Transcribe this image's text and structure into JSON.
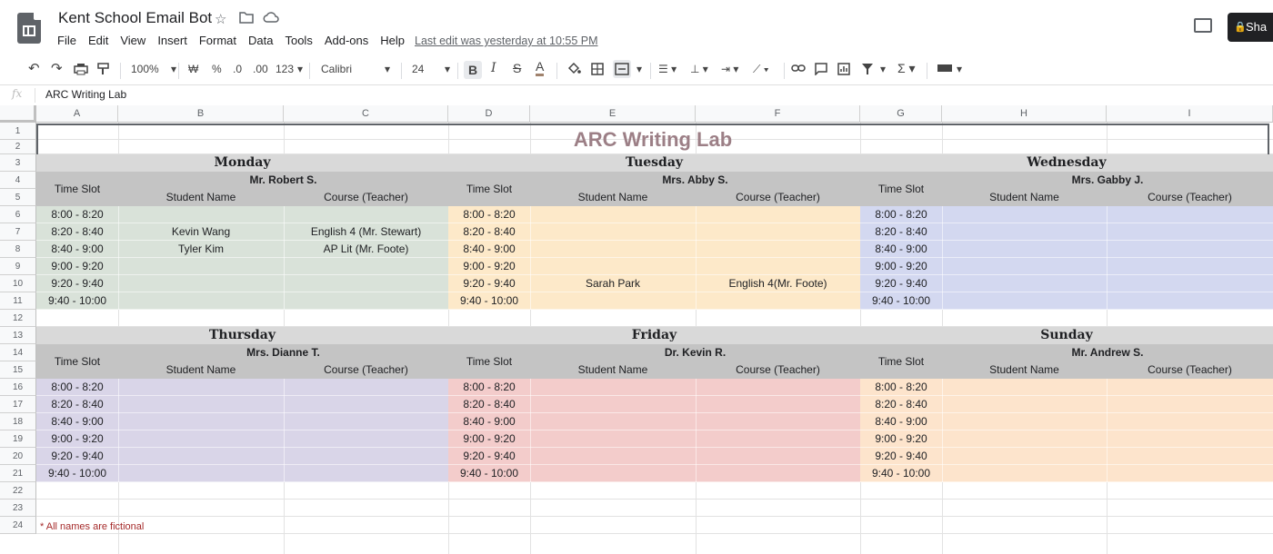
{
  "app": {
    "title": "Kent School Email Bot",
    "menu": [
      "File",
      "Edit",
      "View",
      "Insert",
      "Format",
      "Data",
      "Tools",
      "Add-ons",
      "Help"
    ],
    "last_edit": "Last edit was yesterday at 10:55 PM",
    "share_label": "Sha"
  },
  "toolbar": {
    "zoom": "100%",
    "currency": "₩",
    "percent": "%",
    "dec_less": ".0",
    "dec_more": ".00",
    "number_format": "123",
    "font": "Calibri",
    "font_size": "24"
  },
  "formula_bar": {
    "fx": "fx",
    "value": "ARC Writing Lab"
  },
  "columns": [
    "A",
    "B",
    "C",
    "D",
    "E",
    "F",
    "G",
    "H",
    "I"
  ],
  "rows": [
    "1",
    "2",
    "3",
    "4",
    "5",
    "6",
    "7",
    "8",
    "9",
    "10",
    "11",
    "12",
    "13",
    "14",
    "15",
    "16",
    "17",
    "18",
    "19",
    "20",
    "21",
    "22",
    "23",
    "24"
  ],
  "sheet": {
    "title": "ARC Writing Lab",
    "time_slot_label": "Time Slot",
    "student_label": "Student Name",
    "course_label": "Course (Teacher)",
    "time_slots": [
      "8:00 - 8:20",
      "8:20 - 8:40",
      "8:40 - 9:00",
      "9:00 - 9:20",
      "9:20 - 9:40",
      "9:40 - 10:00"
    ],
    "days": [
      {
        "day": "Monday",
        "tutor": "Mr. Robert S.",
        "color": "#d9e2d9",
        "entries": [
          {
            "student": "",
            "course": ""
          },
          {
            "student": "Kevin Wang",
            "course": "English 4 (Mr. Stewart)"
          },
          {
            "student": "Tyler Kim",
            "course": "AP Lit (Mr. Foote)"
          },
          {
            "student": "",
            "course": ""
          },
          {
            "student": "",
            "course": ""
          },
          {
            "student": "",
            "course": ""
          }
        ]
      },
      {
        "day": "Tuesday",
        "tutor": "Mrs. Abby S.",
        "color": "#fde9c9",
        "entries": [
          {
            "student": "",
            "course": ""
          },
          {
            "student": "",
            "course": ""
          },
          {
            "student": "",
            "course": ""
          },
          {
            "student": "",
            "course": ""
          },
          {
            "student": "Sarah Park",
            "course": "English 4(Mr. Foote)"
          },
          {
            "student": "",
            "course": ""
          }
        ]
      },
      {
        "day": "Wednesday",
        "tutor": "Mrs. Gabby J.",
        "color": "#d3d8f0",
        "entries": [
          {
            "student": "",
            "course": ""
          },
          {
            "student": "",
            "course": ""
          },
          {
            "student": "",
            "course": ""
          },
          {
            "student": "",
            "course": ""
          },
          {
            "student": "",
            "course": ""
          },
          {
            "student": "",
            "course": ""
          }
        ]
      },
      {
        "day": "Thursday",
        "tutor": "Mrs. Dianne T.",
        "color": "#d9d5e8",
        "entries": [
          {
            "student": "",
            "course": ""
          },
          {
            "student": "",
            "course": ""
          },
          {
            "student": "",
            "course": ""
          },
          {
            "student": "",
            "course": ""
          },
          {
            "student": "",
            "course": ""
          },
          {
            "student": "",
            "course": ""
          }
        ]
      },
      {
        "day": "Friday",
        "tutor": "Dr. Kevin R.",
        "color": "#f3cccb",
        "entries": [
          {
            "student": "",
            "course": ""
          },
          {
            "student": "",
            "course": ""
          },
          {
            "student": "",
            "course": ""
          },
          {
            "student": "",
            "course": ""
          },
          {
            "student": "",
            "course": ""
          },
          {
            "student": "",
            "course": ""
          }
        ]
      },
      {
        "day": "Sunday",
        "tutor": "Mr. Andrew S.",
        "color": "#fde4cc",
        "entries": [
          {
            "student": "",
            "course": ""
          },
          {
            "student": "",
            "course": ""
          },
          {
            "student": "",
            "course": ""
          },
          {
            "student": "",
            "course": ""
          },
          {
            "student": "",
            "course": ""
          },
          {
            "student": "",
            "course": ""
          }
        ]
      }
    ],
    "footnote": "* All names are fictional"
  }
}
